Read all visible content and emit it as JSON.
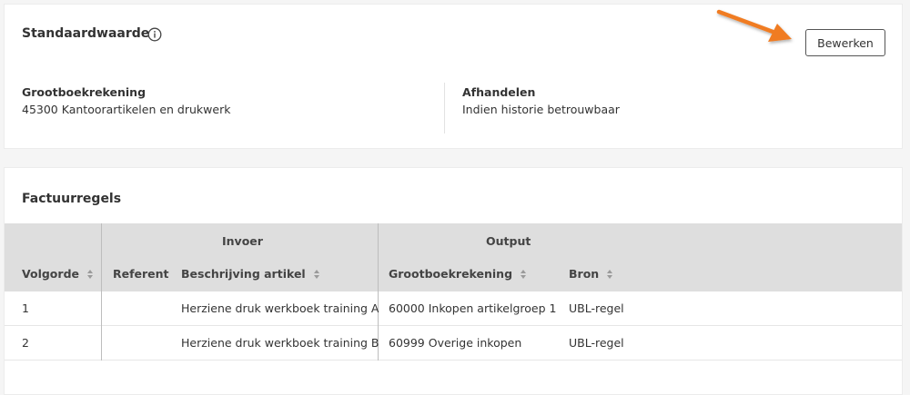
{
  "default_section": {
    "title": "Standaardwaarde",
    "info_icon": "info-circle-icon",
    "edit_label": "Bewerken",
    "fields": {
      "ledger_label": "Grootboekrekening",
      "ledger_value": "45300 Kantoorartikelen en drukwerk",
      "handle_label": "Afhandelen",
      "handle_value": "Indien historie betrouwbaar"
    }
  },
  "invoice_section": {
    "title": "Factuurregels",
    "groups": {
      "input": "Invoer",
      "output": "Output"
    },
    "columns": {
      "order": "Volgorde",
      "referent": "Referent",
      "description": "Beschrijving artikel",
      "ledger": "Grootboekrekening",
      "source": "Bron"
    },
    "rows": [
      {
        "order": "1",
        "referent": "",
        "description": "Herziene druk werkboek training A",
        "ledger": "60000 Inkopen artikelgroep 1",
        "source": "UBL-regel"
      },
      {
        "order": "2",
        "referent": "",
        "description": "Herziene druk werkboek training B",
        "ledger": "60999 Overige inkopen",
        "source": "UBL-regel"
      }
    ]
  },
  "colors": {
    "arrow": "#f07c22",
    "table_header_bg": "#dedede"
  }
}
